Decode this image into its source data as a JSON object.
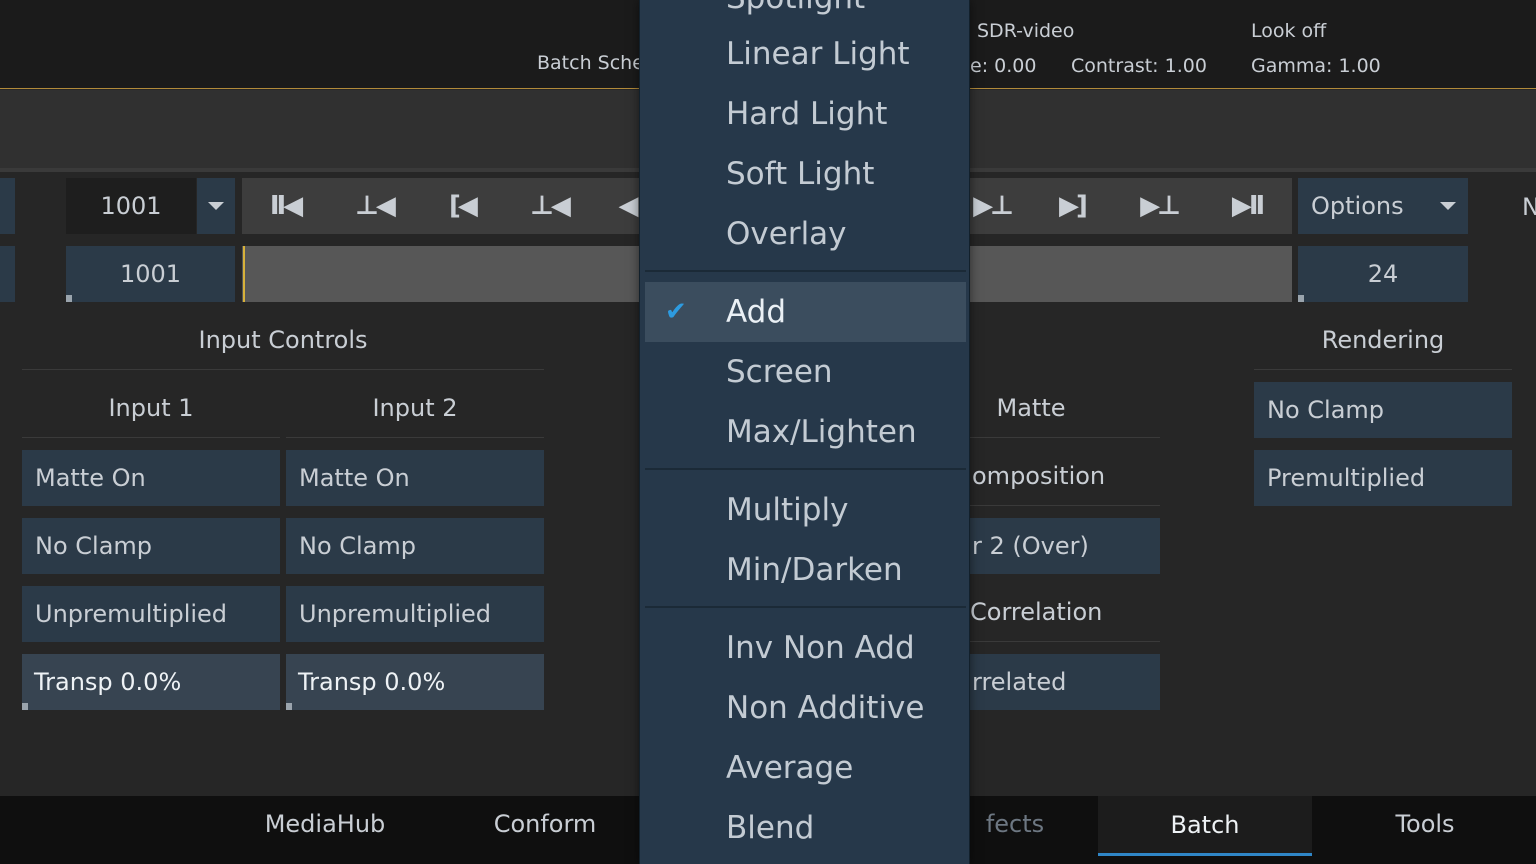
{
  "top_info": {
    "batch_label": "Batch Sche",
    "sdr": "SDR-video",
    "exposure": "e: 0.00",
    "contrast": "Contrast: 1.00",
    "look": "Look off",
    "gamma": "Gamma: 1.00"
  },
  "transport": {
    "frame_value": "1001",
    "options_label": "Options",
    "right_letter": "N"
  },
  "timeline": {
    "start_frame": "1001",
    "fps": "24"
  },
  "input_controls": {
    "title": "Input Controls",
    "input1": {
      "title": "Input 1",
      "matte": "Matte On",
      "clamp": "No Clamp",
      "premult": "Unpremultiplied",
      "transparency": "Transp 0.0%"
    },
    "input2": {
      "title": "Input 2",
      "matte": "Matte On",
      "clamp": "No Clamp",
      "premult": "Unpremultiplied",
      "transparency": "Transp 0.0%"
    }
  },
  "matte_section": {
    "title": "Matte",
    "composition_label": "omposition",
    "composition_value": "r 2 (Over)",
    "correlation_label": "Correlation",
    "correlation_value": "rrelated"
  },
  "rendering": {
    "title": "Rendering",
    "clamp": "No Clamp",
    "premult": "Premultiplied"
  },
  "blend_menu": {
    "items": [
      "Spotlight",
      "Linear Light",
      "Hard Light",
      "Soft Light",
      "Overlay",
      "Add",
      "Screen",
      "Max/Lighten",
      "Multiply",
      "Min/Darken",
      "Inv Non Add",
      "Non Additive",
      "Average",
      "Blend"
    ],
    "selected": "Add"
  },
  "tabs": [
    "MediaHub",
    "Conform",
    "fects",
    "Batch",
    "Tools"
  ],
  "active_tab": "Batch",
  "colors": {
    "accent": "#2f86c7",
    "playhead": "#d7b13a",
    "button": "#2b3a48",
    "menu": "#26384a"
  }
}
